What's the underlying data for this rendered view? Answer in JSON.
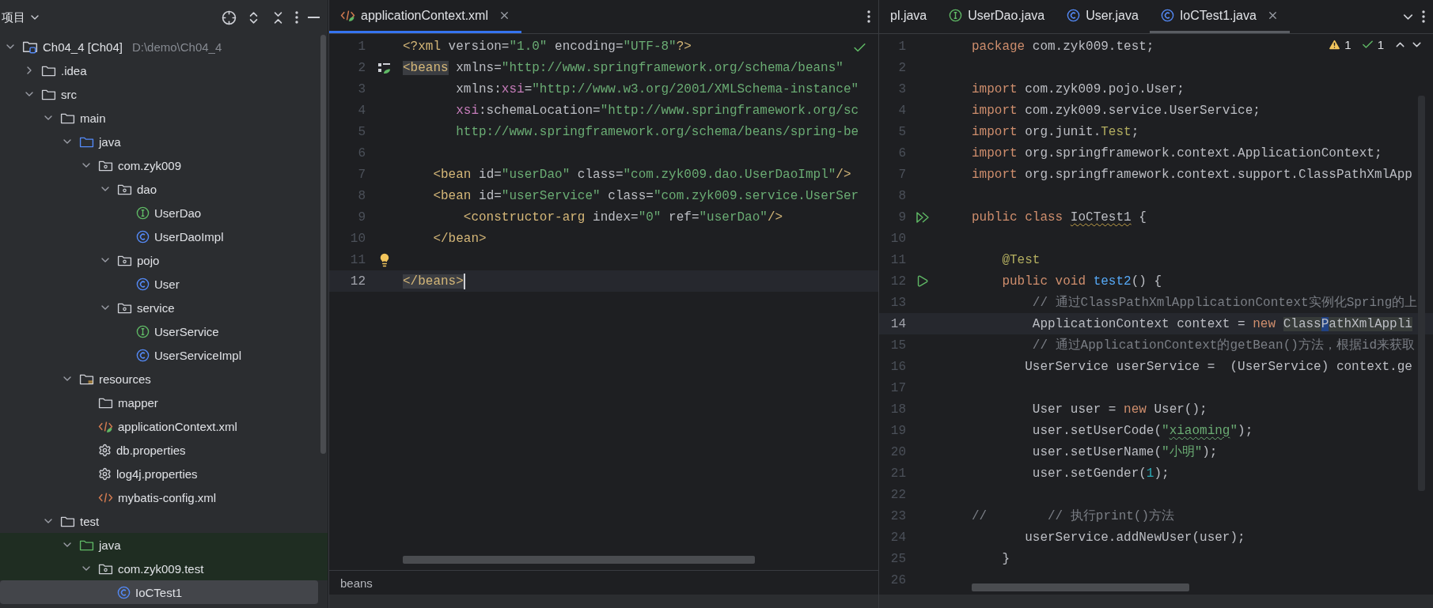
{
  "project_panel": {
    "title": "项目",
    "tree": [
      {
        "label": "Ch04_4 [Ch04]",
        "path": "D:\\demo\\Ch04_4",
        "kind": "module",
        "expanded": true,
        "selected": false,
        "children": [
          {
            "label": ".idea",
            "kind": "folder",
            "expanded": false,
            "selected": false
          },
          {
            "label": "src",
            "kind": "folder",
            "expanded": true,
            "selected": false,
            "children": [
              {
                "label": "main",
                "kind": "folder",
                "expanded": true,
                "selected": false,
                "children": [
                  {
                    "label": "java",
                    "kind": "source-folder",
                    "expanded": true,
                    "selected": false,
                    "children": [
                      {
                        "label": "com.zyk009",
                        "kind": "package",
                        "expanded": true,
                        "selected": false,
                        "children": [
                          {
                            "label": "dao",
                            "kind": "package",
                            "expanded": true,
                            "selected": false,
                            "children": [
                              {
                                "label": "UserDao",
                                "kind": "interface",
                                "selected": false
                              },
                              {
                                "label": "UserDaoImpl",
                                "kind": "class",
                                "selected": false
                              }
                            ]
                          },
                          {
                            "label": "pojo",
                            "kind": "package",
                            "expanded": true,
                            "selected": false,
                            "children": [
                              {
                                "label": "User",
                                "kind": "class",
                                "selected": false
                              }
                            ]
                          },
                          {
                            "label": "service",
                            "kind": "package",
                            "expanded": true,
                            "selected": false,
                            "children": [
                              {
                                "label": "UserService",
                                "kind": "interface",
                                "selected": false
                              },
                              {
                                "label": "UserServiceImpl",
                                "kind": "class",
                                "selected": false
                              }
                            ]
                          }
                        ]
                      }
                    ]
                  },
                  {
                    "label": "resources",
                    "kind": "resources-folder",
                    "expanded": true,
                    "selected": false,
                    "children": [
                      {
                        "label": "mapper",
                        "kind": "folder",
                        "selected": false
                      },
                      {
                        "label": "applicationContext.xml",
                        "kind": "spring-xml",
                        "selected": false
                      },
                      {
                        "label": "db.properties",
                        "kind": "properties",
                        "selected": false
                      },
                      {
                        "label": "log4j.properties",
                        "kind": "properties",
                        "selected": false
                      },
                      {
                        "label": "mybatis-config.xml",
                        "kind": "xml",
                        "selected": false
                      }
                    ]
                  }
                ]
              },
              {
                "label": "test",
                "kind": "folder",
                "expanded": true,
                "selected": false,
                "children": [
                  {
                    "label": "java",
                    "kind": "test-folder",
                    "expanded": true,
                    "selected": false,
                    "test_scope": true,
                    "children": [
                      {
                        "label": "com.zyk009.test",
                        "kind": "package",
                        "expanded": true,
                        "selected": false,
                        "test_scope": true,
                        "children": [
                          {
                            "label": "IoCTest1",
                            "kind": "class",
                            "selected": true
                          }
                        ]
                      }
                    ]
                  }
                ]
              }
            ]
          }
        ]
      }
    ]
  },
  "left_editor": {
    "tabs": [
      {
        "label": "applicationContext.xml",
        "kind": "spring-xml",
        "selected": true,
        "closable": true
      }
    ],
    "breadcrumb": "beans",
    "lines": [
      {
        "number": "1",
        "kind": "code",
        "tokens": [
          {
            "kind": "tag",
            "text": "<?xml"
          },
          {
            "kind": "attr",
            "text": " version"
          },
          {
            "kind": "plain",
            "text": "="
          },
          {
            "kind": "str",
            "text": "\"1.0\""
          },
          {
            "kind": "attr",
            "text": " encoding"
          },
          {
            "kind": "plain",
            "text": "="
          },
          {
            "kind": "str",
            "text": "\"UTF-8\""
          },
          {
            "kind": "tag",
            "text": "?>"
          }
        ]
      },
      {
        "number": "2",
        "kind": "bean",
        "tokens": [
          {
            "kind": "match",
            "text": "<beans"
          },
          {
            "kind": "attr",
            "text": " xmlns"
          },
          {
            "kind": "plain",
            "text": "="
          },
          {
            "kind": "str",
            "text": "\"http://www.springframework.org/schema/beans\""
          }
        ]
      },
      {
        "number": "3",
        "kind": "code",
        "tokens": [
          {
            "kind": "attr",
            "text": "       xmlns:"
          },
          {
            "kind": "ns",
            "text": "xsi"
          },
          {
            "kind": "plain",
            "text": "="
          },
          {
            "kind": "str",
            "text": "\"http://www.w3.org/2001/XMLSchema-instance\""
          }
        ]
      },
      {
        "number": "4",
        "kind": "code",
        "tokens": [
          {
            "kind": "ns",
            "text": "       xsi"
          },
          {
            "kind": "attr",
            "text": ":schemaLocation"
          },
          {
            "kind": "plain",
            "text": "="
          },
          {
            "kind": "str",
            "text": "\"http://www.springframework.org/sc"
          }
        ]
      },
      {
        "number": "5",
        "kind": "code",
        "tokens": [
          {
            "kind": "str",
            "text": "       http://www.springframework.org/schema/beans/spring-be"
          }
        ]
      },
      {
        "number": "6",
        "kind": "code"
      },
      {
        "number": "7",
        "kind": "code",
        "tokens": [
          {
            "kind": "tag",
            "text": "    <bean"
          },
          {
            "kind": "attr",
            "text": " id"
          },
          {
            "kind": "plain",
            "text": "="
          },
          {
            "kind": "str",
            "text": "\"userDao\""
          },
          {
            "kind": "attr",
            "text": " class"
          },
          {
            "kind": "plain",
            "text": "="
          },
          {
            "kind": "str",
            "text": "\"com.zyk009.dao.UserDaoImpl\""
          },
          {
            "kind": "tag",
            "text": "/>"
          }
        ]
      },
      {
        "number": "8",
        "kind": "code",
        "tokens": [
          {
            "kind": "tag",
            "text": "    <bean"
          },
          {
            "kind": "attr",
            "text": " id"
          },
          {
            "kind": "plain",
            "text": "="
          },
          {
            "kind": "str",
            "text": "\"userService\""
          },
          {
            "kind": "attr",
            "text": " class"
          },
          {
            "kind": "plain",
            "text": "="
          },
          {
            "kind": "str",
            "text": "\"com.zyk009.service.UserSer"
          }
        ]
      },
      {
        "number": "9",
        "kind": "code",
        "tokens": [
          {
            "kind": "tag",
            "text": "        <constructor-arg"
          },
          {
            "kind": "attr",
            "text": " index"
          },
          {
            "kind": "plain",
            "text": "="
          },
          {
            "kind": "str",
            "text": "\"0\""
          },
          {
            "kind": "attr",
            "text": " ref"
          },
          {
            "kind": "plain",
            "text": "="
          },
          {
            "kind": "str",
            "text": "\"userDao\""
          },
          {
            "kind": "tag",
            "text": "/>"
          }
        ]
      },
      {
        "number": "10",
        "kind": "code",
        "tokens": [
          {
            "kind": "tag",
            "text": "    </bean>"
          }
        ]
      },
      {
        "number": "11",
        "kind": "bulb"
      },
      {
        "number": "12",
        "kind": "code",
        "current": true,
        "caret": true,
        "tokens": [
          {
            "kind": "match",
            "text": "</beans>"
          }
        ]
      }
    ]
  },
  "right_editor": {
    "tabs": [
      {
        "label": "pl.java",
        "kind": "clipped",
        "selected": false,
        "closable": false
      },
      {
        "label": "UserDao.java",
        "kind": "interface",
        "selected": false,
        "closable": false
      },
      {
        "label": "User.java",
        "kind": "class",
        "selected": false,
        "closable": false
      },
      {
        "label": "IoCTest1.java",
        "kind": "class",
        "selected": true,
        "closable": true
      }
    ],
    "inspections": {
      "warnings": "1",
      "typos": "1"
    },
    "lines": [
      {
        "number": "1",
        "kind": "code",
        "tokens": [
          {
            "kind": "kw",
            "text": "package "
          },
          {
            "kind": "plain",
            "text": "com.zyk009.test;"
          }
        ]
      },
      {
        "number": "2",
        "kind": "code"
      },
      {
        "number": "3",
        "kind": "code",
        "tokens": [
          {
            "kind": "kw",
            "text": "import "
          },
          {
            "kind": "plain",
            "text": "com.zyk009.pojo.User;"
          }
        ]
      },
      {
        "number": "4",
        "kind": "code",
        "tokens": [
          {
            "kind": "kw",
            "text": "import "
          },
          {
            "kind": "plain",
            "text": "com.zyk009.service.UserService;"
          }
        ]
      },
      {
        "number": "5",
        "kind": "code",
        "tokens": [
          {
            "kind": "kw",
            "text": "import "
          },
          {
            "kind": "plain",
            "text": "org.junit."
          },
          {
            "kind": "ann",
            "text": "Test"
          },
          {
            "kind": "plain",
            "text": ";"
          }
        ]
      },
      {
        "number": "6",
        "kind": "code",
        "tokens": [
          {
            "kind": "kw",
            "text": "import "
          },
          {
            "kind": "plain",
            "text": "org.springframework.context.ApplicationContext;"
          }
        ]
      },
      {
        "number": "7",
        "kind": "code",
        "tokens": [
          {
            "kind": "kw",
            "text": "import "
          },
          {
            "kind": "plain",
            "text": "org.springframework.context.support.ClassPathXmlApp"
          }
        ]
      },
      {
        "number": "8",
        "kind": "code"
      },
      {
        "number": "9",
        "kind": "run-all",
        "tokens": [
          {
            "kind": "kw",
            "text": "public class "
          },
          {
            "kind": "warn",
            "text": "IoCTest1"
          },
          {
            "kind": "plain",
            "text": " {"
          }
        ]
      },
      {
        "number": "10",
        "kind": "code"
      },
      {
        "number": "11",
        "kind": "code",
        "tokens": [
          {
            "kind": "ann",
            "text": "    @Test"
          }
        ]
      },
      {
        "number": "12",
        "kind": "run",
        "tokens": [
          {
            "kind": "kw",
            "text": "    public void "
          },
          {
            "kind": "fn",
            "text": "test2"
          },
          {
            "kind": "plain",
            "text": "() {"
          }
        ]
      },
      {
        "number": "13",
        "kind": "code",
        "tokens": [
          {
            "kind": "cmt",
            "text": "        // 通过ClassPathXmlApplicationContext实例化Spring的上"
          }
        ]
      },
      {
        "number": "14",
        "kind": "code",
        "current": true,
        "tokens": [
          {
            "kind": "plain",
            "text": "        ApplicationContext context = "
          },
          {
            "kind": "kw",
            "text": "new "
          },
          {
            "kind": "ref",
            "text": "Class"
          },
          {
            "kind": "refcur",
            "text": "P"
          },
          {
            "kind": "ref",
            "text": "athXmlAppli"
          }
        ]
      },
      {
        "number": "15",
        "kind": "code",
        "tokens": [
          {
            "kind": "cmt",
            "text": "        // 通过ApplicationContext的getBean()方法，根据id来获取"
          }
        ]
      },
      {
        "number": "16",
        "kind": "code",
        "tokens": [
          {
            "kind": "plain",
            "text": "       UserService userService =  (UserService) context.ge"
          }
        ]
      },
      {
        "number": "17",
        "kind": "code"
      },
      {
        "number": "18",
        "kind": "code",
        "tokens": [
          {
            "kind": "plain",
            "text": "        User user = "
          },
          {
            "kind": "kw",
            "text": "new "
          },
          {
            "kind": "plain",
            "text": "User();"
          }
        ]
      },
      {
        "number": "19",
        "kind": "code",
        "tokens": [
          {
            "kind": "plain",
            "text": "        user.setUserCode("
          },
          {
            "kind": "str",
            "text": "\""
          },
          {
            "kind": "typo",
            "text": "xiaoming"
          },
          {
            "kind": "str",
            "text": "\""
          },
          {
            "kind": "plain",
            "text": ");"
          }
        ]
      },
      {
        "number": "20",
        "kind": "code",
        "tokens": [
          {
            "kind": "plain",
            "text": "        user.setUserName("
          },
          {
            "kind": "str",
            "text": "\"小明\""
          },
          {
            "kind": "plain",
            "text": ");"
          }
        ]
      },
      {
        "number": "21",
        "kind": "code",
        "tokens": [
          {
            "kind": "plain",
            "text": "        user.setGender("
          },
          {
            "kind": "num",
            "text": "1"
          },
          {
            "kind": "plain",
            "text": ");"
          }
        ]
      },
      {
        "number": "22",
        "kind": "code"
      },
      {
        "number": "23",
        "kind": "code",
        "tokens": [
          {
            "kind": "cmt",
            "text": "//        // 执行print()方法"
          }
        ]
      },
      {
        "number": "24",
        "kind": "code",
        "tokens": [
          {
            "kind": "plain",
            "text": "       userService.addNewUser(user);"
          }
        ]
      },
      {
        "number": "25",
        "kind": "code",
        "tokens": [
          {
            "kind": "plain",
            "text": "    }"
          }
        ]
      },
      {
        "number": "26",
        "kind": "code"
      }
    ]
  }
}
